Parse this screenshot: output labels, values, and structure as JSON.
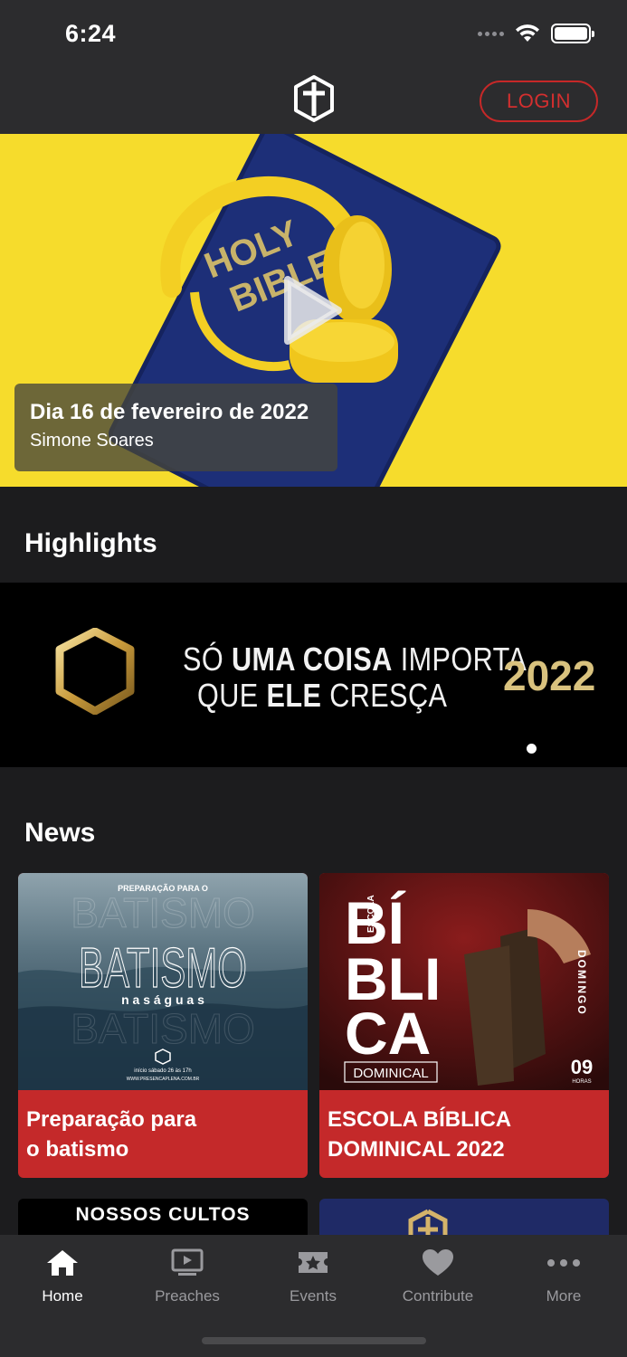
{
  "status_bar": {
    "time": "6:24"
  },
  "header": {
    "login_label": "LOGIN"
  },
  "hero": {
    "title": "Dia 16 de fevereiro de 2022",
    "subtitle": "Simone Soares",
    "book_text_line1": "HOLY",
    "book_text_line2": "BIBLE"
  },
  "highlights": {
    "title": "Highlights",
    "banner": {
      "line1_a": "SÓ ",
      "line1_b": "UMA COISA",
      "line1_c": " IMPORTA",
      "line2_a": "QUE ",
      "line2_b": "ELE",
      "line2_c": " CRESÇA",
      "year": "2022"
    }
  },
  "news": {
    "title": "News",
    "cards": [
      {
        "title_line1": "Preparação para",
        "title_line2": "o batismo",
        "thumb_top": "PREPARAÇÃO PARA O",
        "thumb_main": "BATISMO",
        "thumb_sub": "n a s   á g u a s",
        "thumb_info": "início sábado 26 às 17h",
        "thumb_url": "WWW.PRESENCAPLENA.COM.BR"
      },
      {
        "title_line1": "ESCOLA BÍBLICA",
        "title_line2": "DOMINICAL 2022",
        "thumb_word1": "BÍ",
        "thumb_word2": "BLI",
        "thumb_word3": "CA",
        "thumb_escola": "ESCOLA",
        "thumb_dominical": "DOMINICAL",
        "thumb_domingo": "DOMINGO",
        "thumb_hour": "09",
        "thumb_horas": "HORAS"
      }
    ],
    "partial_card_label": "NOSSOS CULTOS"
  },
  "tab_bar": {
    "items": [
      {
        "label": "Home",
        "icon": "home-icon"
      },
      {
        "label": "Preaches",
        "icon": "tv-play-icon"
      },
      {
        "label": "Events",
        "icon": "ticket-star-icon"
      },
      {
        "label": "Contribute",
        "icon": "heart-icon"
      },
      {
        "label": "More",
        "icon": "ellipsis-icon"
      }
    ],
    "active": "Home"
  },
  "colors": {
    "accent": "#c62828",
    "card_red": "#c4292a",
    "hero_yellow": "#f6dc2c",
    "background": "#1c1c1e",
    "bar": "#2c2c2e",
    "gold": "#d9c27e"
  }
}
